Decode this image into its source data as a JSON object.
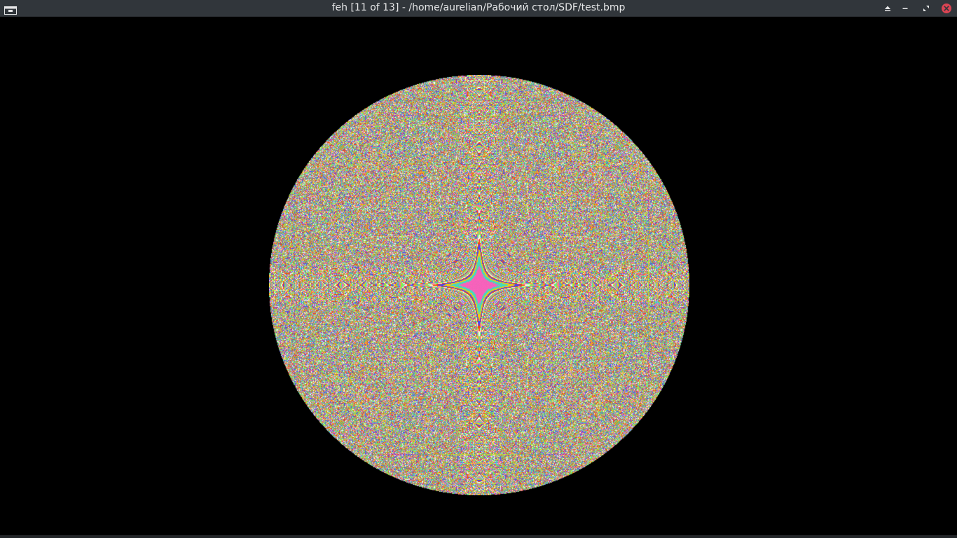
{
  "window": {
    "title": "feh [11 of 13] - /home/aurelian/Рабочий стол/SDF/test.bmp",
    "app": "feh",
    "titlebar_color": "#31363b",
    "title_color": "#e6e7e8",
    "icons": {
      "app_menu": "app-menu-icon",
      "keep_above": "triangle-up-icon",
      "minimize": "minimize-icon",
      "restore": "restore-icon",
      "close": "close-icon"
    },
    "close_color": "#da4453"
  },
  "viewer": {
    "background": "#000000",
    "image": {
      "index": 11,
      "total": 13,
      "path": "/home/aurelian/Рабочий стол/SDF/test.bmp",
      "content": "circular interference pattern",
      "palette": [
        "#ff5fbf",
        "#40e0c0",
        "#ffd000",
        "#4040ff",
        "#ff4000",
        "#ffffff",
        "#80ff40"
      ]
    }
  }
}
